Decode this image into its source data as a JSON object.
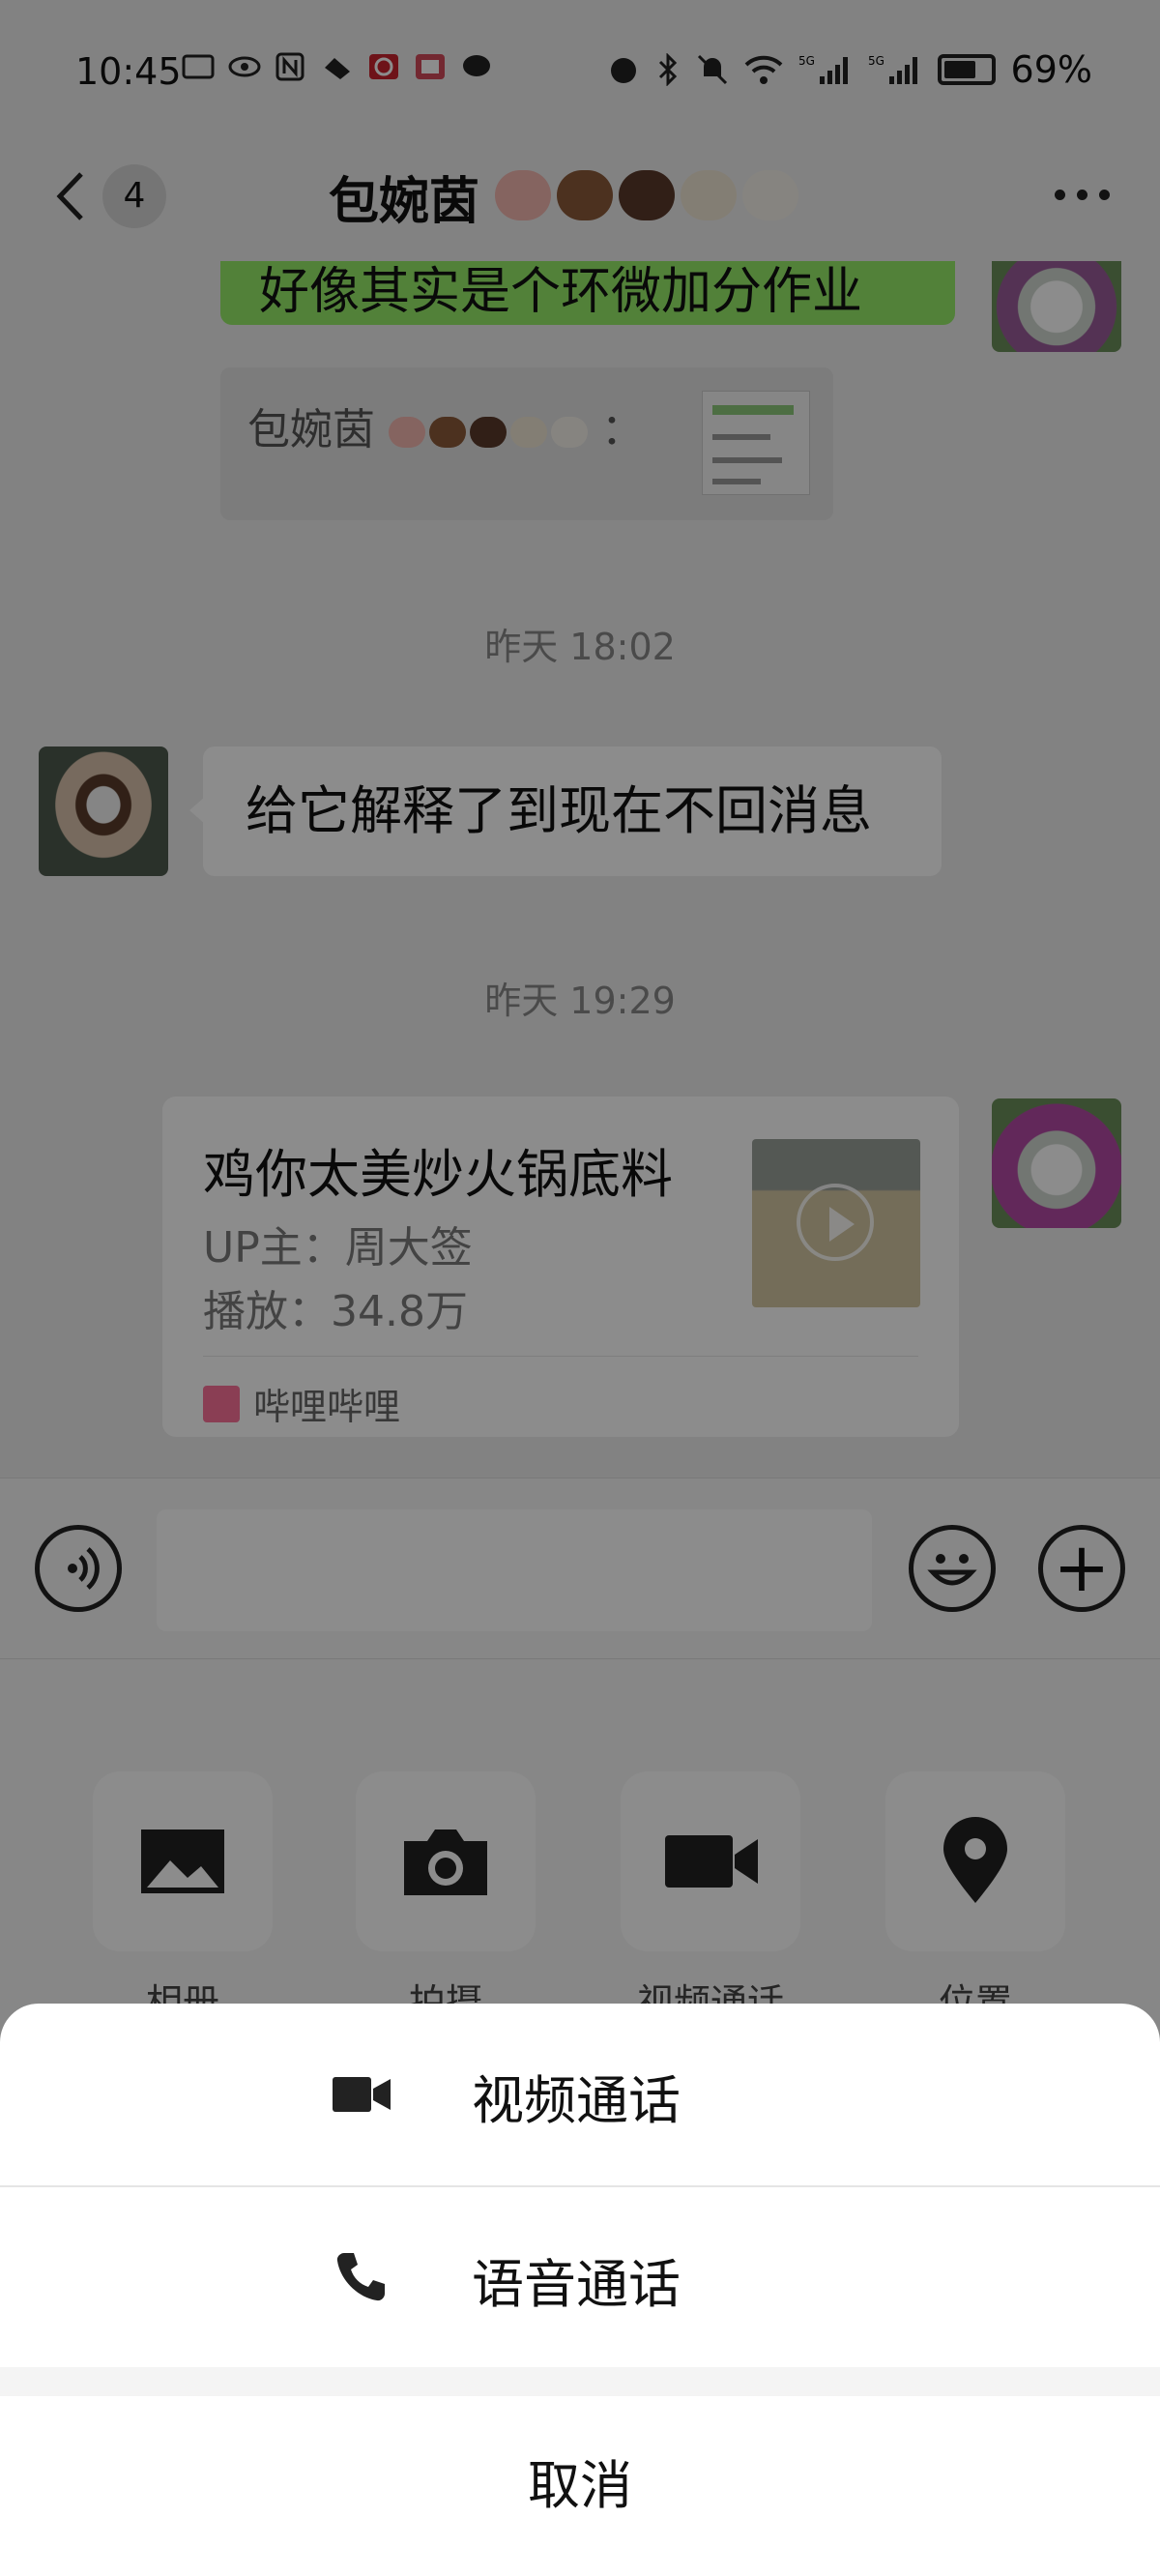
{
  "status_bar": {
    "time": "10:45",
    "battery": "69%",
    "icons": [
      "wifi-icon",
      "signal-5g-icon",
      "signal-5g-icon",
      "bluetooth-icon",
      "mute-icon",
      "alarm-icon",
      "nfc-icon",
      "message-icon"
    ]
  },
  "header": {
    "unread_count": "4",
    "title": "包婉茵",
    "title_emoji": [
      "pig",
      "ox",
      "horse",
      "rooster",
      "egg"
    ]
  },
  "chat": {
    "partial_message": "好像其实是个环微加分作业",
    "quote_sender": "包婉茵",
    "quote_sep": "：",
    "timestamp_1": "昨天 18:02",
    "friend_message": "给它解释了到现在不回消息",
    "timestamp_2": "昨天 19:29",
    "card": {
      "title": "鸡你太美炒火锅底料",
      "uploader": "UP主：周大签",
      "plays": "播放：34.8万",
      "source": "哔哩哔哩"
    }
  },
  "panel": {
    "items": [
      {
        "label": "相册",
        "icon": "image-icon"
      },
      {
        "label": "拍摄",
        "icon": "camera-icon"
      },
      {
        "label": "视频通话",
        "icon": "video-icon"
      },
      {
        "label": "位置",
        "icon": "location-pin-icon"
      }
    ]
  },
  "action_sheet": {
    "video_call": "视频通话",
    "voice_call": "语音通话",
    "cancel": "取消"
  },
  "colors": {
    "bubble_me": "#95ec69",
    "bilibili": "#fb7299"
  }
}
